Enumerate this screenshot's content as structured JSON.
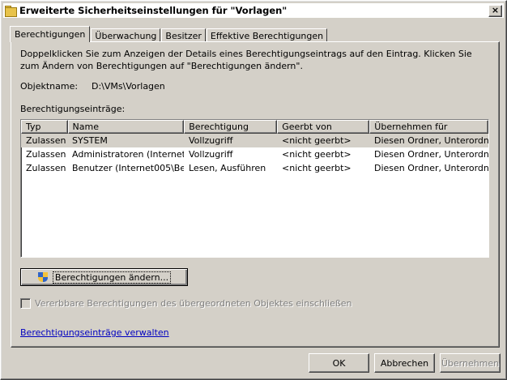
{
  "window": {
    "title": "Erweiterte Sicherheitseinstellungen für \"Vorlagen\"",
    "close_label": "×"
  },
  "tabs": [
    {
      "label": "Berechtigungen",
      "active": true
    },
    {
      "label": "Überwachung",
      "active": false
    },
    {
      "label": "Besitzer",
      "active": false
    },
    {
      "label": "Effektive Berechtigungen",
      "active": false
    }
  ],
  "panel": {
    "description": "Doppelklicken Sie zum Anzeigen der Details eines Berechtigungseintrags auf den Eintrag. Klicken Sie zum Ändern von Berechtigungen auf \"Berechtigungen ändern\".",
    "object_label": "Objektname:",
    "object_value": "D:\\VMs\\Vorlagen",
    "entries_label": "Berechtigungseinträge:",
    "columns": [
      "Typ",
      "Name",
      "Berechtigung",
      "Geerbt von",
      "Übernehmen für"
    ],
    "rows": [
      [
        "Zulassen",
        "SYSTEM",
        "Vollzugriff",
        "<nicht geerbt>",
        "Diesen Ordner, Unterordn..."
      ],
      [
        "Zulassen",
        "Administratoren (Internet0...",
        "Vollzugriff",
        "<nicht geerbt>",
        "Diesen Ordner, Unterordn..."
      ],
      [
        "Zulassen",
        "Benutzer (Internet005\\Be...",
        "Lesen, Ausführen",
        "<nicht geerbt>",
        "Diesen Ordner, Unterordn..."
      ]
    ],
    "change_button": "Berechtigungen ändern...",
    "inherit_checkbox": "Vererbbare Berechtigungen des übergeordneten Objektes einschließen",
    "inherit_checked": false,
    "manage_link": "Berechtigungseinträge verwalten"
  },
  "footer": {
    "ok": "OK",
    "cancel": "Abbrechen",
    "apply": "Übernehmen"
  },
  "icons": {
    "title": "folder-icon",
    "change_button": "uac-shield-icon"
  }
}
